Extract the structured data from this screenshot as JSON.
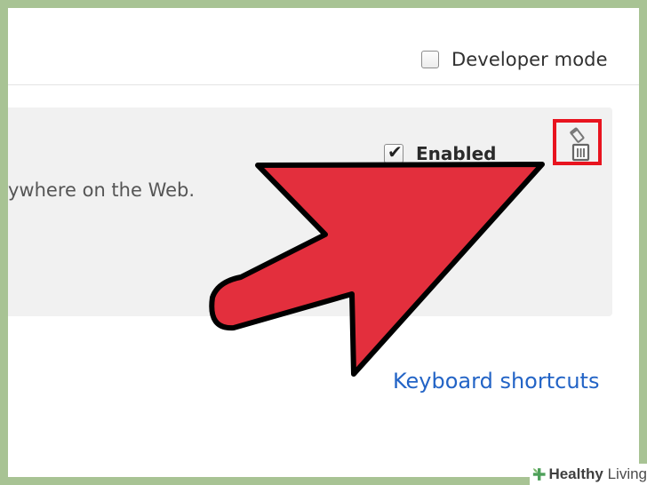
{
  "header": {
    "developer_mode_label": "Developer mode",
    "developer_mode_checked": false
  },
  "extension": {
    "description_fragment": "ywhere on the Web.",
    "enabled_label": "Enabled",
    "enabled_checked": true,
    "remove_icon": "trash-icon"
  },
  "footer": {
    "keyboard_shortcuts_label": "Keyboard shortcuts"
  },
  "watermark": {
    "brand_strong": "Healthy",
    "brand_rest": " Living"
  },
  "colors": {
    "frame_border": "#a8c394",
    "arrow_fill": "#e32f3d",
    "highlight_box": "#e8141f",
    "link": "#2364c6",
    "card_bg": "#f1f1f1"
  }
}
